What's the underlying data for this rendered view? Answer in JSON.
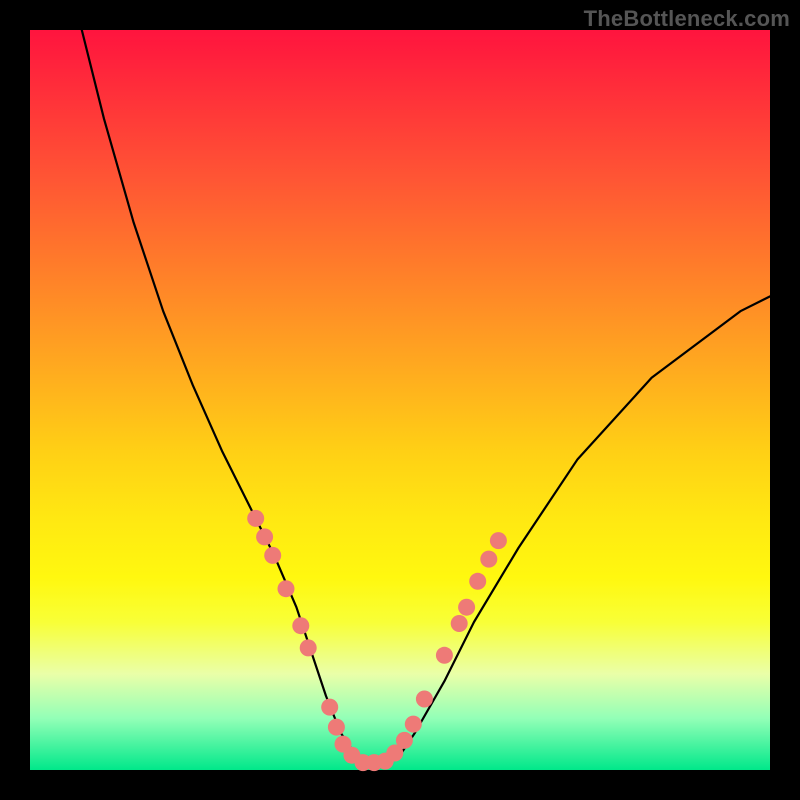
{
  "watermark": "TheBottleneck.com",
  "colors": {
    "frame": "#000000",
    "curve": "#000000",
    "dot_fill": "#ee7a77",
    "dot_stroke": "#cc5754",
    "gradient_top": "#ff143e",
    "gradient_bottom": "#00e88a"
  },
  "chart_data": {
    "type": "line",
    "title": "",
    "xlabel": "",
    "ylabel": "",
    "xlim": [
      0,
      100
    ],
    "ylim": [
      0,
      100
    ],
    "note": "No axis ticks or numeric labels are rendered in the image; x and y are normalized 0–100. y appears to represent a bottleneck percentage (0 = no bottleneck at the well, 100 = worst).",
    "series": [
      {
        "name": "bottleneck-curve",
        "x": [
          7,
          10,
          14,
          18,
          22,
          26,
          30,
          33,
          36,
          38,
          40,
          42,
          44,
          46,
          48,
          50,
          52,
          56,
          60,
          66,
          74,
          84,
          96,
          100
        ],
        "y": [
          100,
          88,
          74,
          62,
          52,
          43,
          35,
          29,
          22,
          16,
          10,
          5,
          2,
          1,
          1,
          2,
          5,
          12,
          20,
          30,
          42,
          53,
          62,
          64
        ]
      }
    ],
    "scatter_overlay": {
      "name": "highlighted-region-dots",
      "points": [
        {
          "x": 30.5,
          "y": 34.0
        },
        {
          "x": 31.7,
          "y": 31.5
        },
        {
          "x": 32.8,
          "y": 29.0
        },
        {
          "x": 34.6,
          "y": 24.5
        },
        {
          "x": 36.6,
          "y": 19.5
        },
        {
          "x": 37.6,
          "y": 16.5
        },
        {
          "x": 40.5,
          "y": 8.5
        },
        {
          "x": 41.4,
          "y": 5.8
        },
        {
          "x": 42.3,
          "y": 3.5
        },
        {
          "x": 43.5,
          "y": 2.0
        },
        {
          "x": 45.0,
          "y": 1.0
        },
        {
          "x": 46.5,
          "y": 1.0
        },
        {
          "x": 48.0,
          "y": 1.2
        },
        {
          "x": 49.3,
          "y": 2.3
        },
        {
          "x": 50.6,
          "y": 4.0
        },
        {
          "x": 51.8,
          "y": 6.2
        },
        {
          "x": 53.3,
          "y": 9.6
        },
        {
          "x": 56.0,
          "y": 15.5
        },
        {
          "x": 58.0,
          "y": 19.8
        },
        {
          "x": 59.0,
          "y": 22.0
        },
        {
          "x": 60.5,
          "y": 25.5
        },
        {
          "x": 62.0,
          "y": 28.5
        },
        {
          "x": 63.3,
          "y": 31.0
        }
      ]
    }
  }
}
